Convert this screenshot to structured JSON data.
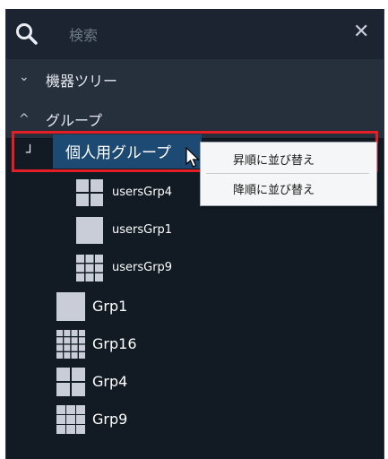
{
  "search": {
    "placeholder": "検索",
    "clear_icon": "close-icon",
    "search_icon": "search-icon"
  },
  "sections": [
    {
      "label": "機器ツリー",
      "state": "collapsed"
    },
    {
      "label": "グループ",
      "state": "expanded"
    }
  ],
  "selected_group": {
    "label": "個人用グループ"
  },
  "context_menu": {
    "items": [
      "昇順に並び替え",
      "降順に並び替え"
    ]
  },
  "subgroups": [
    {
      "label": "usersGrp4",
      "icon": "layout-2x2-icon"
    },
    {
      "label": "usersGrp1",
      "icon": "layout-1x1-icon"
    },
    {
      "label": "usersGrp9",
      "icon": "layout-3x3-icon"
    }
  ],
  "groups": [
    {
      "label": "Grp1",
      "icon": "layout-1x1-icon"
    },
    {
      "label": "Grp16",
      "icon": "layout-4x4-icon"
    },
    {
      "label": "Grp4",
      "icon": "layout-2x2-icon"
    },
    {
      "label": "Grp9",
      "icon": "layout-3x3-icon"
    }
  ],
  "colors": {
    "highlight_border": "#e41e25",
    "selected_row": "#1d4a73",
    "layout_tile": "#c8cdd8"
  }
}
